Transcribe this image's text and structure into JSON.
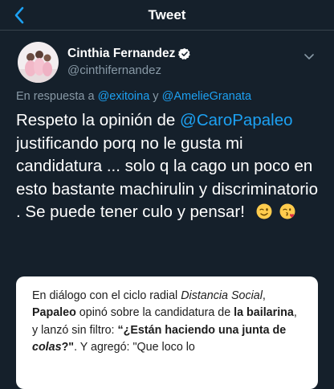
{
  "header": {
    "title": "Tweet"
  },
  "author": {
    "display_name": "Cinthia Fernandez",
    "handle": "@cinthifernandez",
    "verified": true
  },
  "reply": {
    "prefix": "En respuesta a ",
    "to_1": "@exitoina",
    "joiner": " y ",
    "to_2": "@AmelieGranata"
  },
  "tweet": {
    "part1": "Respeto la opinión de ",
    "mention": "@CaroPapaleo",
    "part2": " justificando porq no le gusta mi candidatura ... solo q la cago un poco en esto bastante machirulin y discriminatorio . Se puede tener culo y pensar!",
    "emojis": [
      "winking-face",
      "face-blowing-kiss"
    ]
  },
  "card": {
    "t1": "En diálogo con el ciclo radial ",
    "t2": "Distancia Social",
    "t3": ",",
    "t4": "Papaleo",
    "t5": " opinó sobre la candidatura de ",
    "t6": "la bailarina",
    "t7": ", y lanzó sin filtro: ",
    "t8": "“¿Están haciendo una junta de ",
    "t9": "colas",
    "t10": "?\"",
    "t11": ". Y agregó: \"Que loco lo"
  },
  "colors": {
    "background": "#15202b",
    "accent": "#1da1f2",
    "secondary_text": "#8899a6",
    "divider": "#38444d"
  }
}
